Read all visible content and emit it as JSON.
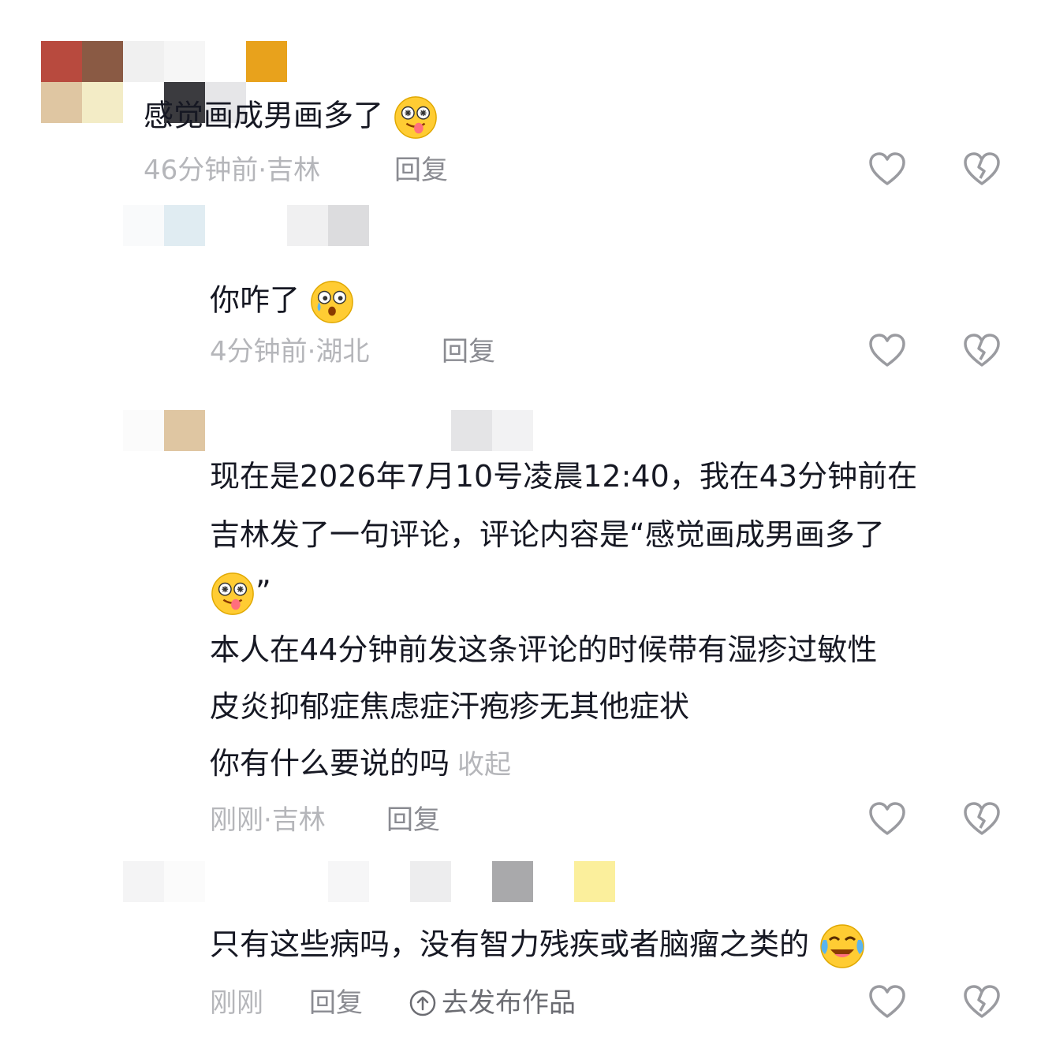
{
  "comments": [
    {
      "text": "感觉画成男画多了",
      "emoji": "drooling-face-emoji",
      "time": "46分钟前",
      "location": "吉林",
      "reply_label": "回复"
    },
    {
      "text": "你咋了",
      "emoji": "surprised-sweat-face-emoji",
      "time": "4分钟前",
      "location": "湖北",
      "reply_label": "回复"
    },
    {
      "lines": [
        "现在是2026年7月10号凌晨12:40，我在43分钟前在",
        "吉林发了一句评论，评论内容是“感觉画成男画多了",
        "”",
        "本人在44分钟前发这条评论的时候带有湿疹过敏性",
        "皮炎抑郁症焦虑症汗疱疹无其他症状",
        "你有什么要说的吗"
      ],
      "collapse_label": "收起",
      "time": "刚刚",
      "location": "吉林",
      "reply_label": "回复"
    },
    {
      "text": "只有这些病吗，没有智力残疾或者脑瘤之类的",
      "emoji": "crying-laughing-face-emoji",
      "time": "刚刚",
      "reply_label": "回复",
      "publish_label": "去发布作品"
    }
  ],
  "icons": {
    "like": "heart-outline-icon",
    "dislike": "broken-heart-icon",
    "publish": "up-arrow-circle-icon"
  },
  "colors": {
    "text": "#161823",
    "meta": "#b5b6ba",
    "reply": "#8a8b91",
    "icon": "#9a9ba0",
    "emoji_face": "#ffcc33"
  }
}
